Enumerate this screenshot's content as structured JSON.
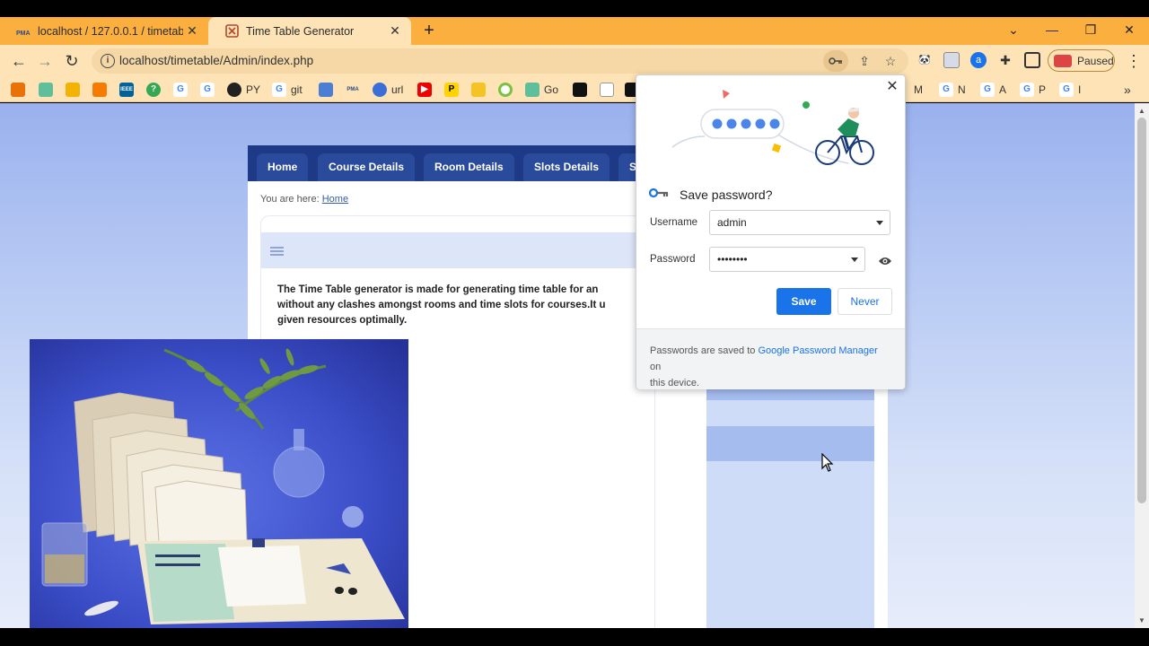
{
  "tabs": [
    {
      "title": "localhost / 127.0.0.1 / timetable /",
      "icon": "phpmyadmin-icon"
    },
    {
      "title": "Time Table Generator",
      "icon": "timetable-icon"
    }
  ],
  "address_bar": {
    "url": "localhost/timetable/Admin/index.php"
  },
  "profile": {
    "status": "Paused"
  },
  "bookmarks": [
    {
      "label": "PY",
      "icon": "github-icon"
    },
    {
      "label": "git",
      "icon": "google-icon"
    },
    {
      "label": "url",
      "icon": "wifi-icon"
    },
    {
      "label": "Go",
      "icon": "chatgpt-icon"
    },
    {
      "label": "M",
      "icon": "google-icon"
    },
    {
      "label": "N",
      "icon": "google-icon"
    },
    {
      "label": "A",
      "icon": "google-icon"
    },
    {
      "label": "P",
      "icon": "google-icon"
    },
    {
      "label": "I",
      "icon": "google-icon"
    }
  ],
  "site": {
    "nav": [
      "Home",
      "Course Details",
      "Room Details",
      "Slots Details",
      "S"
    ],
    "breadcrumb_prefix": "You are here:",
    "breadcrumb_link": "Home",
    "intro_lines": [
      "The Time Table generator is made for generating time table for an",
      "without any clashes amongst rooms and time slots for courses.It u",
      "given resources optimally."
    ]
  },
  "password_dialog": {
    "title": "Save password?",
    "username_label": "Username",
    "username_value": "admin",
    "password_label": "Password",
    "password_value": "••••••••",
    "save_label": "Save",
    "never_label": "Never",
    "footer_prefix": "Passwords are saved to",
    "footer_link": "Google Password Manager",
    "footer_suffix": "on",
    "footer_line2": "this device."
  },
  "colors": {
    "tabbar": "#fbaf3f",
    "toolbar": "#fde3b5",
    "nav_bg": "#1e3a86",
    "accent": "#1a73e8"
  }
}
